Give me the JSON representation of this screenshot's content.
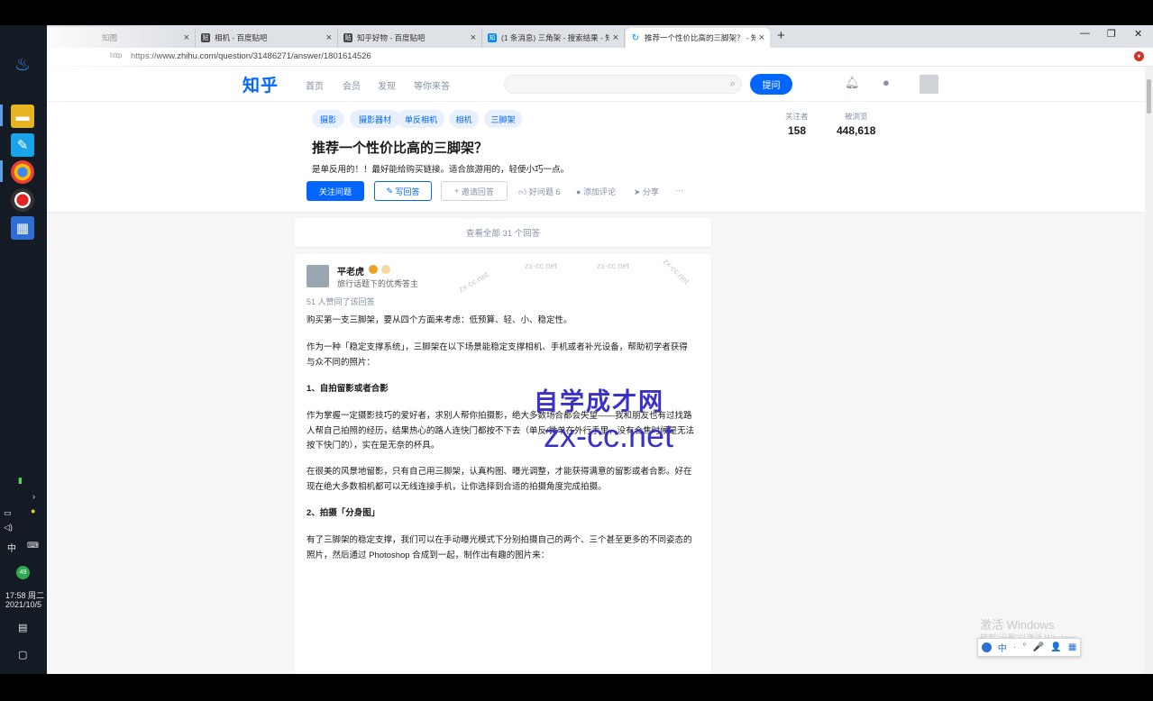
{
  "taskbar": {
    "clock_time": "17:58 周二",
    "clock_date": "2021/10/5",
    "ime": "中"
  },
  "browser": {
    "tabs": [
      {
        "label": "知图"
      },
      {
        "label": "相机 - 百度贴吧"
      },
      {
        "label": "知乎好物 - 百度贴吧"
      },
      {
        "label": "(1 条消息) 三角架 - 搜索结果 - 知"
      },
      {
        "label": "推荐一个性价比高的三脚架？ - 知"
      }
    ],
    "new_tab": "+",
    "url_prefix": "http",
    "url": "https://www.zhihu.com/question/31486271/answer/1801614526"
  },
  "zhihu": {
    "logo": "知乎",
    "nav": [
      "首页",
      "会员",
      "发现",
      "等你来答"
    ],
    "ask_button": "提问"
  },
  "question": {
    "topics": [
      "摄影",
      "摄影器材",
      "单反相机",
      "相机",
      "三脚架"
    ],
    "title": "推荐一个性价比高的三脚架？",
    "detail": "是单反用的！！最好能给购买链接。适合旅游用的，轻便小巧一点。",
    "follow_button": "关注问题",
    "write_button": "写回答",
    "invite_button": "邀请回答",
    "good_question": "好问题 6",
    "add_comment": "添加评论",
    "share": "分享",
    "more": "···",
    "followers_label": "关注者",
    "followers": "158",
    "views_label": "被浏览",
    "views": "448,618"
  },
  "view_all": "查看全部 31 个回答",
  "answer": {
    "author": "平老虎",
    "bio": "旅行话题下的优秀答主",
    "upvoters": "51 人赞同了该回答",
    "paragraphs": [
      "购买第一支三脚架，要从四个方面来考虑：低预算、轻、小、稳定性。",
      "作为一种「稳定支撑系统」，三脚架在以下场景能稳定支撑相机、手机或者补光设备，帮助初学者获得与众不同的照片：",
      "1、自拍留影或者合影",
      "作为掌握一定摄影技巧的爱好者，求别人帮你拍摄影，绝大多数场合都会失望——我和朋友也有过找路人帮自己拍照的经历，结果热心的路人连快门都按不下去（单反/微单在外行手里，没有合焦时候是无法按下快门的），实在是无奈的杯具。",
      "在很美的风景地留影，只有自己用三脚架，认真构图、曝光调整，才能获得满意的留影或者合影。好在现在绝大多数相机都可以无线连接手机，让你选择到合适的拍摄角度完成拍摄。",
      "2、拍摄「分身图」",
      "有了三脚架的稳定支撑，我们可以在手动曝光模式下分别拍摄自己的两个、三个甚至更多的不同姿态的照片，然后通过 Photoshop 合成到一起，制作出有趣的图片来："
    ]
  },
  "watermark": {
    "title": "自学成才网",
    "url": "zx-cc.net",
    "small": "zx-cc.net"
  },
  "windows_activation": {
    "line1": "激活 Windows",
    "line2": "转到\"设置\"以激活 Windows。"
  },
  "ime_toolbar": [
    "中",
    "·",
    "°",
    "🎤",
    "👤",
    "▦"
  ]
}
